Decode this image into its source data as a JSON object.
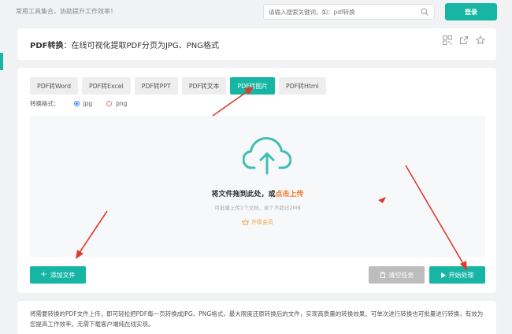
{
  "header": {
    "tagline": "常用工具集合，协助提升工作效率！",
    "search_placeholder": "请输入搜索关键词，如：pdf转换",
    "login_label": "登录"
  },
  "titlebar": {
    "title_bold": "PDF转换",
    "title_rest": "：在线可视化提取PDF分页为JPG、PNG格式",
    "icons": [
      "qrcode-icon",
      "share-icon",
      "star-icon"
    ]
  },
  "tabs": [
    {
      "label": "PDF转Word",
      "active": false
    },
    {
      "label": "PDF转Excel",
      "active": false
    },
    {
      "label": "PDF转PPT",
      "active": false
    },
    {
      "label": "PDF转文本",
      "active": false
    },
    {
      "label": "PDF转图片",
      "active": true
    },
    {
      "label": "PDF转Html",
      "active": false
    }
  ],
  "format": {
    "label": "转换格式：",
    "options": [
      {
        "label": "jpg",
        "selected": true
      },
      {
        "label": "png",
        "selected": false
      }
    ]
  },
  "dropzone": {
    "main_text": "将文件拖到此处，或",
    "main_link": "点击上传",
    "sub_text": "可批量上传1个文档，单个不超过2MB",
    "upgrade_text": "升级会员"
  },
  "actions": {
    "add_label": "添加文件",
    "clear_label": "清空任务",
    "start_label": "开始处理"
  },
  "description": "将需要转换的PDF文件上传，即可轻松把PDF每一页转换成JPG、PNG格式，最大限度还原转换后的文件，实现高质量的转换效果。可单次进行转换也可批量进行转换，有效为您提高工作效率。无需下载客户端纯在线实现。",
  "colors": {
    "accent": "#17b5a4",
    "link": "#f07c2c",
    "upgrade": "#f0a24a",
    "disabled": "#bdbdbd",
    "annotation": "#e03a2e"
  }
}
